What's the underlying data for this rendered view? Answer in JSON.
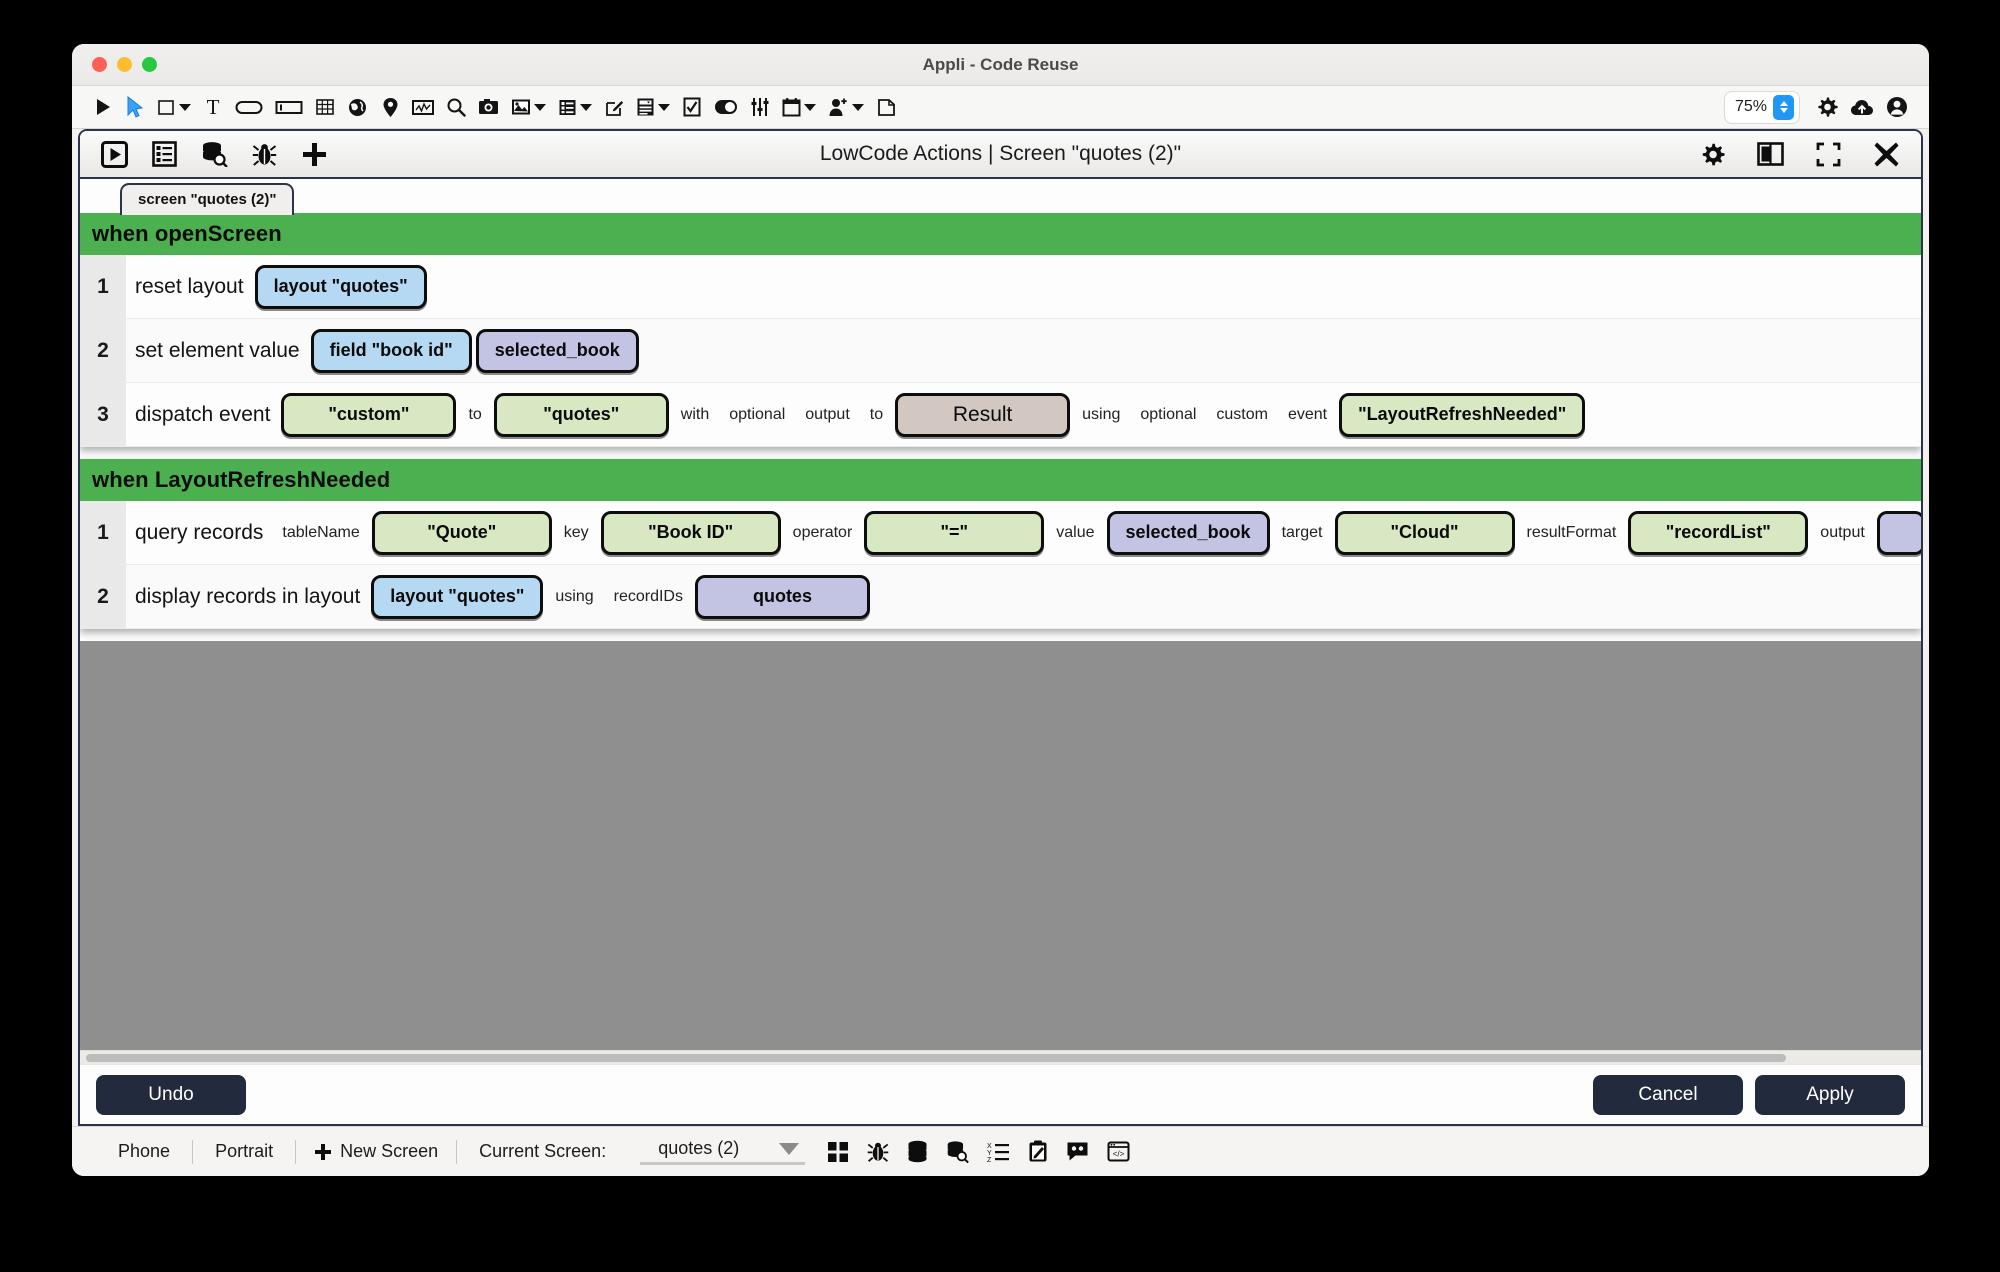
{
  "window": {
    "title": "Appli - Code Reuse",
    "traffic_lights": [
      "close",
      "minimize",
      "maximize"
    ]
  },
  "toolbar": {
    "zoom_value": "75%",
    "items": [
      {
        "name": "play-icon",
        "label": "Play"
      },
      {
        "name": "pointer-icon",
        "label": "Select"
      },
      {
        "name": "rectangle-icon",
        "label": "Rectangle",
        "caret": true
      },
      {
        "name": "text-icon",
        "label": "Text"
      },
      {
        "name": "button-icon",
        "label": "Button"
      },
      {
        "name": "input-field-icon",
        "label": "Input field"
      },
      {
        "name": "table-icon",
        "label": "Table"
      },
      {
        "name": "globe-icon",
        "label": "Web"
      },
      {
        "name": "map-pin-icon",
        "label": "Map"
      },
      {
        "name": "chart-icon",
        "label": "Chart"
      },
      {
        "name": "search-icon",
        "label": "Search"
      },
      {
        "name": "camera-icon",
        "label": "Camera"
      },
      {
        "name": "image-icon",
        "label": "Image",
        "caret": true
      },
      {
        "name": "list-icon",
        "label": "List",
        "caret": true
      },
      {
        "name": "edit-icon",
        "label": "Edit"
      },
      {
        "name": "form-icon",
        "label": "Form",
        "caret": true
      },
      {
        "name": "checkbox-icon",
        "label": "Checkbox"
      },
      {
        "name": "toggle-icon",
        "label": "Toggle"
      },
      {
        "name": "sliders-icon",
        "label": "Sliders"
      },
      {
        "name": "calendar-icon",
        "label": "Calendar",
        "caret": true
      },
      {
        "name": "add-user-icon",
        "label": "Add user",
        "caret": true
      },
      {
        "name": "copy-icon",
        "label": "Duplicate"
      }
    ],
    "right_items": [
      {
        "name": "gear-icon",
        "label": "Settings"
      },
      {
        "name": "cloud-upload-icon",
        "label": "Upload"
      },
      {
        "name": "account-icon",
        "label": "Account"
      }
    ]
  },
  "lowcode": {
    "title": "LowCode Actions | Screen \"quotes (2)\"",
    "header_left_icons": [
      {
        "name": "run-icon",
        "label": "Run"
      },
      {
        "name": "list-view-icon",
        "label": "List view"
      },
      {
        "name": "data-search-icon",
        "label": "Data search"
      },
      {
        "name": "debug-icon",
        "label": "Debug"
      },
      {
        "name": "add-icon",
        "label": "Add"
      }
    ],
    "header_right_icons": [
      {
        "name": "gear-icon",
        "label": "Settings"
      },
      {
        "name": "split-view-icon",
        "label": "Split view"
      },
      {
        "name": "fullscreen-icon",
        "label": "Fullscreen"
      },
      {
        "name": "close-icon",
        "label": "Close"
      }
    ],
    "tab_label": "screen \"quotes (2)\"",
    "rules": [
      {
        "event_title": "when openScreen",
        "statements": [
          {
            "num": "1",
            "verb": "reset layout",
            "parts": [
              {
                "kind": "chip",
                "color": "blue",
                "text": "layout \"quotes\"",
                "width": "w-big"
              }
            ]
          },
          {
            "num": "2",
            "verb": "set element value",
            "parts": [
              {
                "kind": "chip",
                "color": "blue",
                "text": "field \"book id\"",
                "width": "w-big"
              },
              {
                "kind": "chip",
                "color": "purple",
                "text": "selected_book",
                "width": "w-big"
              }
            ]
          },
          {
            "num": "3",
            "verb": "dispatch event",
            "parts": [
              {
                "kind": "chip",
                "color": "green",
                "text": "\"custom\"",
                "width": "w-xl"
              },
              {
                "kind": "label",
                "text": "to"
              },
              {
                "kind": "chip",
                "color": "green",
                "text": "\"quotes\"",
                "width": "w-xl"
              },
              {
                "kind": "label",
                "text": "with"
              },
              {
                "kind": "label",
                "text": "optional"
              },
              {
                "kind": "label",
                "text": "output"
              },
              {
                "kind": "label",
                "text": "to"
              },
              {
                "kind": "chip",
                "color": "taupe",
                "text": "Result",
                "width": "w-xl"
              },
              {
                "kind": "label",
                "text": "using"
              },
              {
                "kind": "label",
                "text": "optional"
              },
              {
                "kind": "label",
                "text": "custom"
              },
              {
                "kind": "label",
                "text": "event"
              },
              {
                "kind": "chip",
                "color": "green",
                "text": "\"LayoutRefreshNeeded\"",
                "width": ""
              }
            ]
          }
        ]
      },
      {
        "event_title": "when LayoutRefreshNeeded",
        "statements": [
          {
            "num": "1",
            "verb": "query records",
            "parts": [
              {
                "kind": "label",
                "text": "tableName"
              },
              {
                "kind": "chip",
                "color": "green",
                "text": "\"Quote\"",
                "width": "w-xxl"
              },
              {
                "kind": "label",
                "text": "key"
              },
              {
                "kind": "chip",
                "color": "green",
                "text": "\"Book ID\"",
                "width": "w-xxl"
              },
              {
                "kind": "label",
                "text": "operator"
              },
              {
                "kind": "chip",
                "color": "green",
                "text": "\"=\"",
                "width": "w-xxl"
              },
              {
                "kind": "label",
                "text": "value"
              },
              {
                "kind": "chip",
                "color": "purple",
                "text": "selected_book",
                "width": "w-big"
              },
              {
                "kind": "label",
                "text": "target"
              },
              {
                "kind": "chip",
                "color": "green",
                "text": "\"Cloud\"",
                "width": "w-xxl"
              },
              {
                "kind": "label",
                "text": "resultFormat"
              },
              {
                "kind": "chip",
                "color": "green",
                "text": "\"recordList\"",
                "width": "w-xxl"
              },
              {
                "kind": "label",
                "text": "output"
              },
              {
                "kind": "chip",
                "color": "purple",
                "text": "",
                "width": ""
              }
            ]
          },
          {
            "num": "2",
            "verb": "display records in layout",
            "parts": [
              {
                "kind": "chip",
                "color": "blue",
                "text": "layout \"quotes\"",
                "width": "w-big"
              },
              {
                "kind": "label",
                "text": "using"
              },
              {
                "kind": "label",
                "text": "recordIDs"
              },
              {
                "kind": "chip",
                "color": "purple",
                "text": "quotes",
                "width": "w-xl"
              }
            ]
          }
        ]
      }
    ]
  },
  "footer": {
    "undo_label": "Undo",
    "cancel_label": "Cancel",
    "apply_label": "Apply"
  },
  "statusbar": {
    "device": "Phone",
    "orientation": "Portrait",
    "new_screen_label": "New Screen",
    "current_screen_label": "Current Screen:",
    "current_screen_value": "quotes (2)",
    "icons": [
      {
        "name": "grid-icon",
        "label": "Screens grid"
      },
      {
        "name": "debug-icon",
        "label": "Debug"
      },
      {
        "name": "database-icon",
        "label": "Database"
      },
      {
        "name": "database-search-icon",
        "label": "Query database"
      },
      {
        "name": "sort-list-icon",
        "label": "Sort list"
      },
      {
        "name": "clipboard-edit-icon",
        "label": "Notes"
      },
      {
        "name": "chat-icon",
        "label": "Chat"
      },
      {
        "name": "code-preview-icon",
        "label": "Code preview"
      }
    ]
  },
  "colors": {
    "accent_green": "#4caf50",
    "chip_green": "#d8e8c2",
    "chip_blue": "#b5d9f2",
    "chip_purple": "#c3c3e4",
    "chip_taupe": "#d3c7c2",
    "dark_button": "#222b3d",
    "canvas_gray": "#8f8f8f"
  }
}
